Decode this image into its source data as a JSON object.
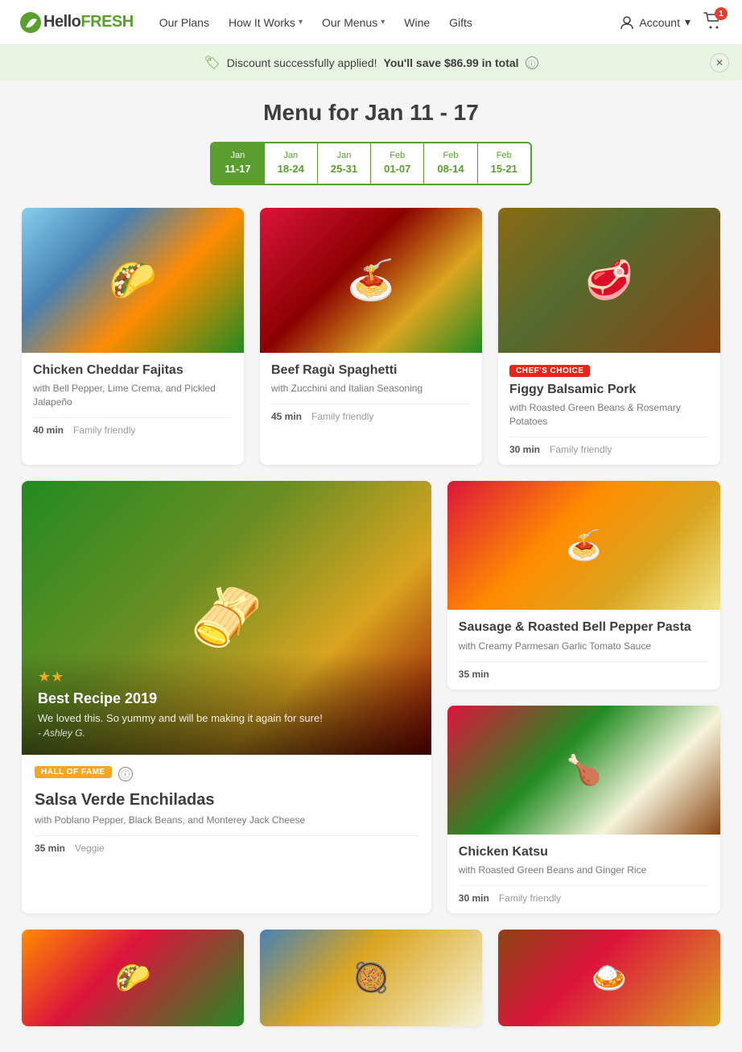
{
  "brand": {
    "name_hello": "Hello",
    "name_fresh": "FRESH",
    "logo_emoji": "🌿"
  },
  "nav": {
    "links": [
      {
        "label": "Our Plans",
        "has_dropdown": false
      },
      {
        "label": "How It Works",
        "has_dropdown": true
      },
      {
        "label": "Our Menus",
        "has_dropdown": true
      },
      {
        "label": "Wine",
        "has_dropdown": false
      },
      {
        "label": "Gifts",
        "has_dropdown": false
      }
    ],
    "account_label": "Account",
    "cart_count": "1"
  },
  "discount_banner": {
    "applied_text": "Discount successfully applied!",
    "save_text": "You'll save $86.99 in total"
  },
  "menu": {
    "title": "Menu for Jan 11 - 17",
    "date_tabs": [
      {
        "month": "Jan",
        "days": "11-17",
        "active": true
      },
      {
        "month": "Jan",
        "days": "18-24",
        "active": false
      },
      {
        "month": "Jan",
        "days": "25-31",
        "active": false
      },
      {
        "month": "Feb",
        "days": "01-07",
        "active": false
      },
      {
        "month": "Feb",
        "days": "08-14",
        "active": false
      },
      {
        "month": "Feb",
        "days": "15-21",
        "active": false
      }
    ]
  },
  "meals": {
    "row1": [
      {
        "id": "fajitas",
        "name": "Chicken Cheddar Fajitas",
        "desc": "with Bell Pepper, Lime Crema, and Pickled Jalapeño",
        "time": "40 min",
        "tag": "Family friendly",
        "badge": null,
        "img_class": "img-fajitas",
        "emoji": "🌮"
      },
      {
        "id": "spaghetti",
        "name": "Beef Ragù Spaghetti",
        "desc": "with Zucchini and Italian Seasoning",
        "time": "45 min",
        "tag": "Family friendly",
        "badge": null,
        "img_class": "img-spaghetti",
        "emoji": "🍝"
      },
      {
        "id": "pork",
        "name": "Figgy Balsamic Pork",
        "desc": "with Roasted Green Beans & Rosemary Potatoes",
        "time": "30 min",
        "tag": "Family friendly",
        "badge": "CHEF'S CHOICE",
        "badge_type": "chefs",
        "img_class": "img-pork",
        "emoji": "🥩"
      }
    ],
    "featured": {
      "id": "enchiladas",
      "name": "Salsa Verde Enchiladas",
      "desc": "with Poblano Pepper, Black Beans, and Monterey Jack Cheese",
      "time": "35 min",
      "tag": "Veggie",
      "badge": "HALL OF FAME",
      "badge_type": "hall",
      "recipe_year": "Best Recipe 2019",
      "quote": "We loved this. So yummy and will be making it again for sure!",
      "author": "- Ashley G.",
      "img_class": "img-enchiladas",
      "emoji": "🫔",
      "stars": "★★"
    },
    "right_cards": [
      {
        "id": "pasta",
        "name": "Sausage & Roasted Bell Pepper Pasta",
        "desc": "with Creamy Parmesan Garlic Tomato Sauce",
        "time": "35 min",
        "tag": null,
        "badge": null,
        "img_class": "img-pasta",
        "emoji": "🍝"
      },
      {
        "id": "katsu",
        "name": "Chicken Katsu",
        "desc": "with Roasted Green Beans and Ginger Rice",
        "time": "30 min",
        "tag": "Family friendly",
        "badge": null,
        "img_class": "img-katsu",
        "emoji": "🍗"
      }
    ],
    "bottom_partial": [
      {
        "id": "bottom1",
        "img_class": "img-bottom1",
        "emoji": "🌮"
      },
      {
        "id": "bottom2",
        "img_class": "img-bottom2",
        "emoji": "🥘"
      },
      {
        "id": "bottom3",
        "img_class": "img-bottom3",
        "emoji": "🍛"
      }
    ]
  }
}
